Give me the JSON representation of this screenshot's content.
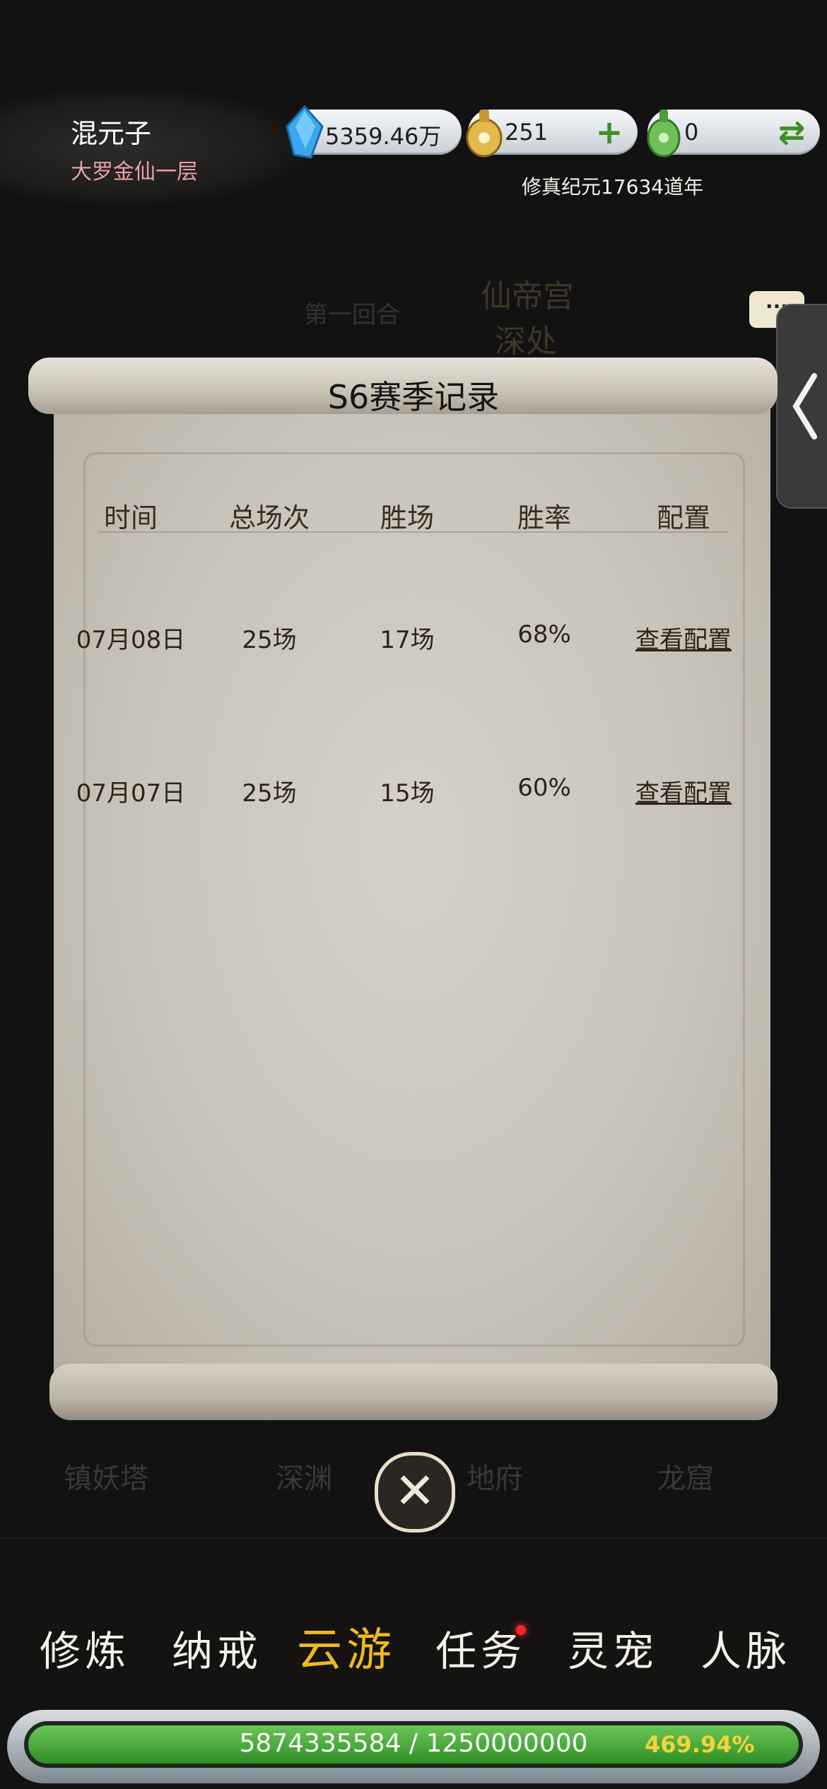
{
  "player": {
    "name": "混元子",
    "realm": "大罗金仙一层"
  },
  "resources": {
    "spirit_stone": "5359.46万",
    "gold": "251",
    "jade": "0"
  },
  "era": "修真纪元17634道年",
  "background": {
    "round_text": "第一回合",
    "place_line1": "仙帝宫",
    "place_line2": "深处",
    "locations": [
      "镇妖塔",
      "深渊",
      "地府",
      "龙窟"
    ]
  },
  "more_button": "···",
  "scroll": {
    "title": "S6赛季记录",
    "columns": [
      "时间",
      "总场次",
      "胜场",
      "胜率",
      "配置"
    ],
    "rows": [
      {
        "date": "07月08日",
        "total": "25场",
        "wins": "17场",
        "rate": "68%",
        "config": "查看配置"
      },
      {
        "date": "07月07日",
        "total": "25场",
        "wins": "15场",
        "rate": "60%",
        "config": "查看配置"
      }
    ]
  },
  "close_symbol": "✕",
  "nav": [
    {
      "label": "修炼"
    },
    {
      "label": "纳戒"
    },
    {
      "label": "云游"
    },
    {
      "label": "任务"
    },
    {
      "label": "灵宠"
    },
    {
      "label": "人脉"
    }
  ],
  "exp": {
    "text": "5874335584 / 1250000000",
    "percent": "469.94%",
    "fill": 1.0
  },
  "colors": {
    "active_nav": "#f1b81f",
    "exp_fill": "#3f9f30",
    "realm": "#e7a2a2"
  }
}
